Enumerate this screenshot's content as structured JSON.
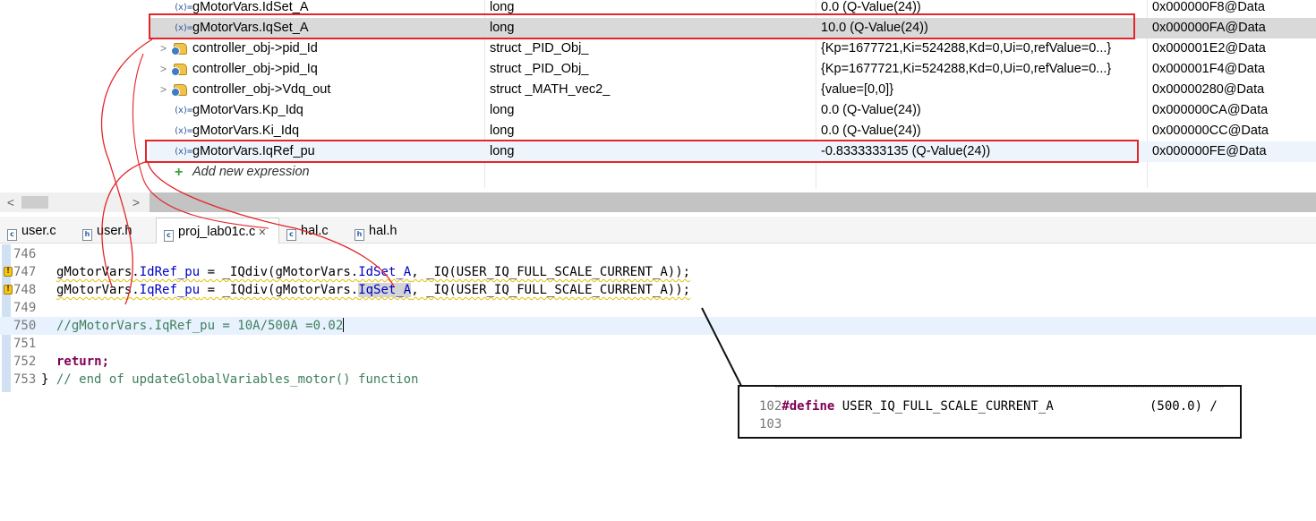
{
  "expressions": {
    "rows": [
      {
        "icon": "variable-icon",
        "expander": "",
        "name": "gMotorVars.IdSet_A",
        "type": "long",
        "value": "0.0 (Q-Value(24))",
        "address": "0x000000F8@Data"
      },
      {
        "icon": "variable-icon",
        "expander": "",
        "name": "gMotorVars.IqSet_A",
        "type": "long",
        "value": "10.0 (Q-Value(24))",
        "address": "0x000000FA@Data"
      },
      {
        "icon": "struct-icon",
        "expander": ">",
        "name": "controller_obj->pid_Id",
        "type": "struct _PID_Obj_",
        "value": "{Kp=1677721,Ki=524288,Kd=0,Ui=0,refValue=0...}",
        "address": "0x000001E2@Data"
      },
      {
        "icon": "struct-icon",
        "expander": ">",
        "name": "controller_obj->pid_Iq",
        "type": "struct _PID_Obj_",
        "value": "{Kp=1677721,Ki=524288,Kd=0,Ui=0,refValue=0...}",
        "address": "0x000001F4@Data"
      },
      {
        "icon": "struct-icon",
        "expander": ">",
        "name": "controller_obj->Vdq_out",
        "type": "struct _MATH_vec2_",
        "value": "{value=[0,0]}",
        "address": "0x00000280@Data"
      },
      {
        "icon": "variable-icon",
        "expander": "",
        "name": "gMotorVars.Kp_Idq",
        "type": "long",
        "value": "0.0 (Q-Value(24))",
        "address": "0x000000CA@Data"
      },
      {
        "icon": "variable-icon",
        "expander": "",
        "name": "gMotorVars.Ki_Idq",
        "type": "long",
        "value": "0.0 (Q-Value(24))",
        "address": "0x000000CC@Data"
      },
      {
        "icon": "variable-icon",
        "expander": "",
        "name": "gMotorVars.IqRef_pu",
        "type": "long",
        "value": "-0.8333333135 (Q-Value(24))",
        "address": "0x000000FE@Data"
      }
    ],
    "add_new": "Add new expression",
    "var_icon_glyph": "(x)=",
    "selected_row": "gMotorVars.IqSet_A"
  },
  "tabs": [
    {
      "label": "user.c",
      "icon": "c-file-icon",
      "glyph": "c"
    },
    {
      "label": "user.h",
      "icon": "h-file-icon",
      "glyph": "h"
    },
    {
      "label": "proj_lab01c.c",
      "icon": "c-file-icon",
      "glyph": "c",
      "active": true,
      "close": "✕"
    },
    {
      "label": "hal.c",
      "icon": "c-file-icon",
      "glyph": "c"
    },
    {
      "label": "hal.h",
      "icon": "h-file-icon",
      "glyph": "h"
    }
  ],
  "editor": {
    "line_numbers": [
      "746",
      "747",
      "748",
      "749",
      "750",
      "751",
      "752",
      "753"
    ],
    "l747": {
      "lhs_obj": "gMotorVars",
      "lhs_dot": ".",
      "lhs_field": "IdRef_pu",
      "mid": " = _IQdiv(",
      "arg_obj": "gMotorVars",
      "arg_dot": ".",
      "arg_field": "IdSet_A",
      "tail": ", _IQ(USER_IQ_FULL_SCALE_CURRENT_A));"
    },
    "l748": {
      "lhs_obj": "gMotorVars",
      "lhs_dot": ".",
      "lhs_field": "IqRef_pu",
      "mid": " = _IQdiv(",
      "arg_obj": "gMotorVars",
      "arg_dot": ".",
      "arg_field": "IqSet_A",
      "tail": ", _IQ(USER_IQ_FULL_SCALE_CURRENT_A));"
    },
    "l750": "//gMotorVars.IqRef_pu = 10A/500A =0.02",
    "l752": "return;",
    "l753_brace": "}",
    "l753_comment": " // end of updateGlobalVariables_motor() function",
    "warning_glyph": "!"
  },
  "callout": {
    "line1_num": "102",
    "define_kw": "#define",
    "define_name": " USER_IQ_FULL_SCALE_CURRENT_A",
    "define_value": "(500.0) /",
    "line2_num": "103"
  },
  "scroll": {
    "left_arrow": "<",
    "right_arrow": ">"
  },
  "colors": {
    "annotation_red": "#e3262b",
    "selection": "#d9d9d9",
    "highlight": "#eef4fb",
    "current_line": "#e8f2fe"
  }
}
